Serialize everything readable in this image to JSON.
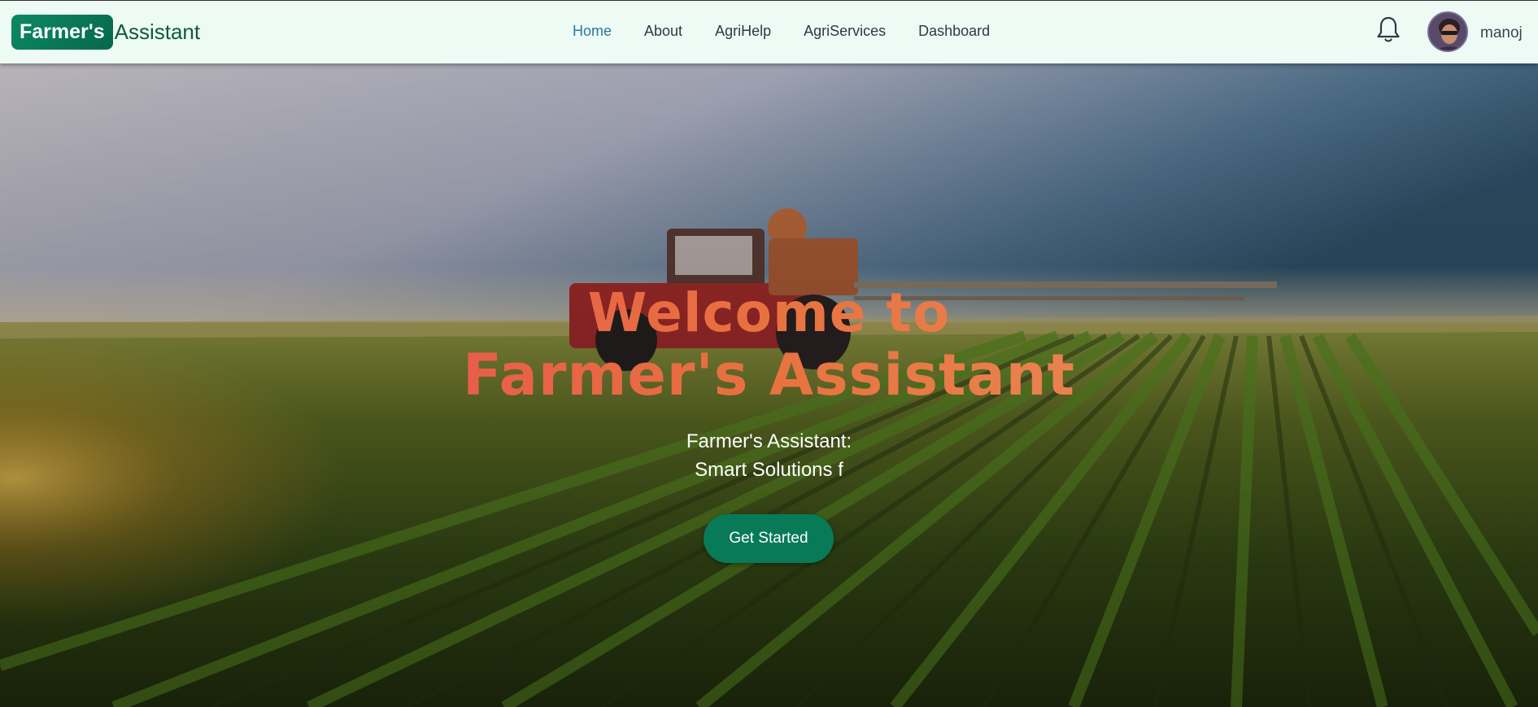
{
  "brand": {
    "badge": "Farmer's",
    "rest": "Assistant"
  },
  "nav": {
    "items": [
      {
        "label": "Home",
        "active": true
      },
      {
        "label": "About",
        "active": false
      },
      {
        "label": "AgriHelp",
        "active": false
      },
      {
        "label": "AgriServices",
        "active": false
      },
      {
        "label": "Dashboard",
        "active": false
      }
    ]
  },
  "user": {
    "name": "manoj",
    "notification_icon": "bell-icon"
  },
  "hero": {
    "title_line1": "Welcome to",
    "title_line2": "Farmer's Assistant",
    "subtitle_line1": "Farmer's Assistant:",
    "subtitle_line2": "Smart Solutions f",
    "cta_label": "Get Started"
  },
  "colors": {
    "nav_bg": "#eefaf4",
    "brand_green": "#087a57",
    "nav_active": "#2a79a0",
    "title_gradient_start": "#e9405a",
    "title_gradient_end": "#ea9a6a"
  }
}
